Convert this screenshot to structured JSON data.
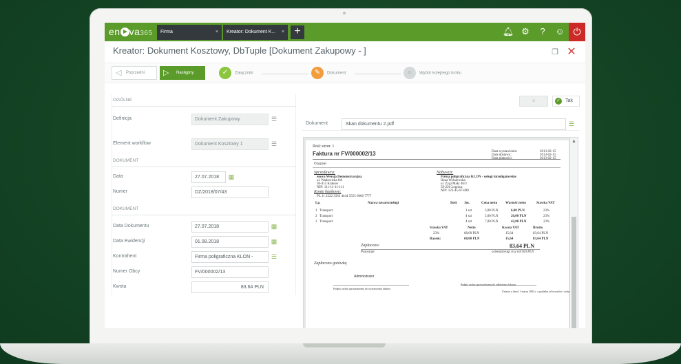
{
  "app": {
    "logo_text": "en",
    "logo_text2": "va",
    "logo_num": "365",
    "tabs": [
      {
        "label": "Firma",
        "close": "×"
      },
      {
        "label": "Kreator: Dokument K...",
        "close": "×"
      }
    ],
    "new_tab": "+"
  },
  "title": "Kreator: Dokument Kosztowy, DbTuple [Dokument Zakupowy - ]",
  "wizard": {
    "prev_label": "Poprzedni",
    "next_label": "Następny",
    "steps": [
      {
        "label": "Załączniki",
        "state": "done"
      },
      {
        "label": "Dokument",
        "state": "current"
      },
      {
        "label": "Wybór kolejnego kroku",
        "state": "pending"
      }
    ]
  },
  "form": {
    "section_general": "OGÓLNE",
    "definicja": {
      "label": "Definicja",
      "value": "Dokument Zakupowy"
    },
    "workflow": {
      "label": "Element workflow",
      "value": "Dokument Kosztowy 1"
    },
    "section_doc1": "DOKUMENT",
    "data": {
      "label": "Data",
      "value": "27.07.2018"
    },
    "numer": {
      "label": "Numer",
      "value": "DZ/2018/07/43"
    },
    "section_doc2": "DOKUMENT",
    "data_dokumentu": {
      "label": "Data Dokumentu",
      "value": "27.07.2018"
    },
    "data_ewidencji": {
      "label": "Data Ewidencji",
      "value": "01.08.2018"
    },
    "kontrahent": {
      "label": "Kontrahent",
      "value": "Firma poligraficzna KLON - "
    },
    "numer_obcy": {
      "label": "Numer Obcy",
      "value": "FV/000002/13"
    },
    "kwota": {
      "label": "Kwota",
      "value": "83.64 PLN"
    }
  },
  "right": {
    "back_label": "<",
    "ok_label": "Tak",
    "doc_label": "Dokument",
    "doc_value": "Skan dokumentu 2.pdf"
  },
  "invoice": {
    "page_label": "Ilość stron: 1",
    "title": "Faktura nr FV/000002/13",
    "orig": "Oryginał",
    "seller_head": "Sprzedawca:",
    "seller_lines": [
      "enova Wersja Demonstracyjna",
      "ul. Wadowicka 8A",
      "30-415 Kraków",
      "NIP: 111-11-11-111"
    ],
    "bank": "Konto bankowe:",
    "bank_line": "PL 11 2222 3333 4444 5555 6666 7777",
    "buyer_head": "Nabywca:",
    "buyer_lines": [
      "Firma poligraficzna KLON - usługi introligatorskie",
      "Ilona Wiśniewska",
      "ul. Zygi Mały 46/3",
      "59-220 Legnica",
      "NIP: 123-45-67-890"
    ],
    "dates": [
      "Data wystawienia:",
      "Data dostawy:",
      "Data płatności:"
    ],
    "date_vals": [
      "2013-02-15",
      "2013-02-15",
      "2013-02-15"
    ],
    "col_headers": [
      "Lp.",
      "Nazwa towaru/usługi",
      "Ilość",
      "Jm.",
      "Cena netto",
      "Wartość netto",
      "Stawka VAT"
    ],
    "items": [
      [
        "1",
        "Transport",
        "1 szt",
        "3,00 PLN",
        "6,00 PLN",
        "23%"
      ],
      [
        "2",
        "Transport",
        "4 szt",
        "5,00 PLN",
        "20,00 PLN",
        "23%"
      ],
      [
        "3",
        "Transport",
        "4 szt",
        "7,00 PLN",
        "42,00 PLN",
        "23%"
      ]
    ],
    "sum_headers": [
      "Stawka VAT",
      "Netto",
      "Kwota VAT",
      "Brutto"
    ],
    "sum_row": [
      "23%",
      "68,00 PLN",
      "15,64",
      "83,64 PLN"
    ],
    "total_label": "Razem:",
    "total_row": [
      "68,00 PLN",
      "15,64",
      "83,64 PLN"
    ],
    "paid_label": "Zapłacono:",
    "paid_value": "83,64 PLN",
    "remaining_label": "Pozostaje:",
    "in_words": "osiemdziesiąt trzy 64/100 PLN",
    "notes": "Zapłacono gotówką",
    "issuer": "Administrator",
    "sig_left": "Podpis osoby upoważnionej do wystawienia faktury",
    "sig_right": "Podpis osoby upoważnionej do odbierania faktury",
    "footer": "Ustawa z dnia 11 marca 2004 r. o podatku od towarów i usług"
  }
}
